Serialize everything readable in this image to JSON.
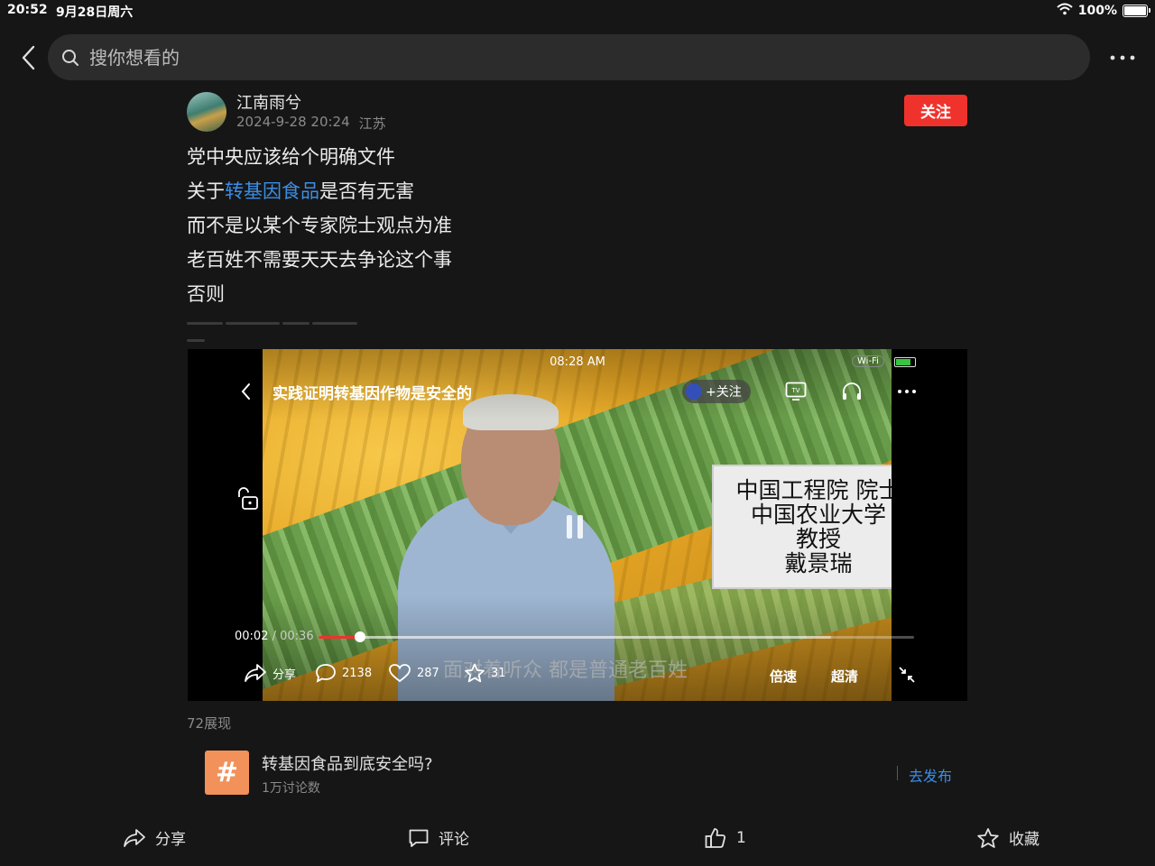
{
  "status_bar": {
    "time": "20:52",
    "date": "9月28日周六",
    "battery": "100%"
  },
  "search": {
    "placeholder": "搜你想看的"
  },
  "post": {
    "author": "江南雨兮",
    "datetime": "2024-9-28 20:24",
    "location": "江苏",
    "follow_label": "关注",
    "lines": [
      "党中央应该给个明确文件",
      "而不是以某个专家院士观点为准",
      "老百姓不需要天天去争论这个事",
      "否则"
    ],
    "line2_prefix": "关于",
    "line2_link": "转基因食品",
    "line2_suffix": "是否有无害"
  },
  "video": {
    "clock": "08:28 AM",
    "wifi": "Wi-Fi",
    "title": "实践证明转基因作物是安全的",
    "follow_label": "+关注",
    "info_card": [
      "中国工程院 院士",
      "中国农业大学",
      "教授",
      "戴景瑞"
    ],
    "current_time": "00:02",
    "duration": "/ 00:36",
    "progress": 0.07,
    "buffered": 0.86,
    "subtitle": "面对着听众 都是普通老百姓",
    "share_label": "分享",
    "comments": "2138",
    "likes": "287",
    "favorites": "31",
    "speed_label": "倍速",
    "quality_label": "超清",
    "battery_color": "#35c73e"
  },
  "impressions": "72展现",
  "topic": {
    "icon": "#",
    "title": "转基因食品到底安全吗?",
    "count": "1万讨论数",
    "publish_label": "去发布"
  },
  "bottom_bar": {
    "share": "分享",
    "comment": "评论",
    "like_count": "1",
    "favorite": "收藏"
  },
  "colors": {
    "accent": "#f0322d",
    "link": "#3a8ee6",
    "background": "#161616"
  }
}
